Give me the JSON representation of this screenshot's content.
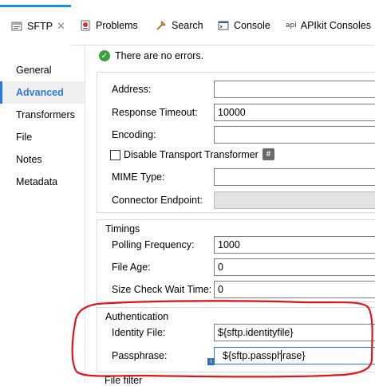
{
  "tabs": [
    {
      "label": "SFTP",
      "icon": "sftp-icon",
      "active": true
    },
    {
      "label": "Problems",
      "icon": "problems-icon"
    },
    {
      "label": "Search",
      "icon": "search-icon"
    },
    {
      "label": "Console",
      "icon": "console-icon"
    },
    {
      "label": "APIkit Consoles",
      "icon": "api-icon",
      "badge": "api"
    }
  ],
  "sidebar": {
    "items": [
      {
        "label": "General"
      },
      {
        "label": "Advanced",
        "selected": true
      },
      {
        "label": "Transformers"
      },
      {
        "label": "File"
      },
      {
        "label": "Notes"
      },
      {
        "label": "Metadata"
      }
    ]
  },
  "status": {
    "message": "There are no errors."
  },
  "general_group": {
    "address_label": "Address:",
    "address_value": "",
    "response_timeout_label": "Response Timeout:",
    "response_timeout_value": "10000",
    "encoding_label": "Encoding:",
    "encoding_value": "",
    "disable_transformer_label": "Disable Transport Transformer",
    "disable_transformer_checked": false,
    "hash_symbol": "#",
    "mime_type_label": "MIME Type:",
    "mime_type_value": "",
    "connector_endpoint_label": "Connector Endpoint:",
    "connector_endpoint_value": ""
  },
  "timings": {
    "title": "Timings",
    "polling_frequency_label": "Polling Frequency:",
    "polling_frequency_value": "1000",
    "file_age_label": "File Age:",
    "file_age_value": "0",
    "size_check_label": "Size Check Wait Time:",
    "size_check_value": "0"
  },
  "authentication": {
    "title": "Authentication",
    "identity_file_label": "Identity File:",
    "identity_file_value": "${sftp.identityfile}",
    "passphrase_label": "Passphrase:",
    "passphrase_value": "${sftp.passphrase}",
    "info_symbol": "i"
  },
  "file_filter": {
    "title": "File filter"
  },
  "colors": {
    "accent": "#1b8fe8",
    "annotation": "#e0141c",
    "ok": "#3aa43a"
  }
}
